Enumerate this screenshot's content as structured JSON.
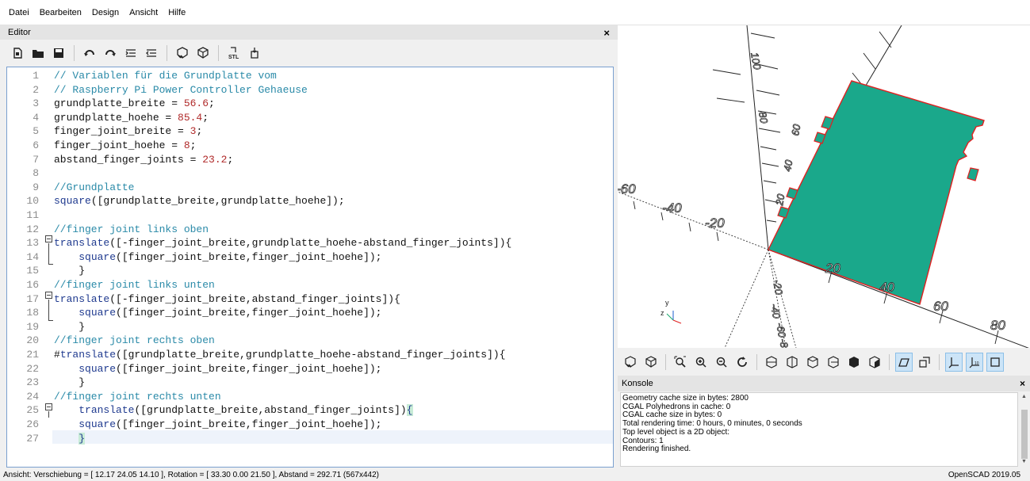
{
  "menu": [
    "Datei",
    "Bearbeiten",
    "Design",
    "Ansicht",
    "Hilfe"
  ],
  "editor": {
    "title": "Editor",
    "close": "×",
    "line_numbers": [
      "1",
      "2",
      "3",
      "4",
      "5",
      "6",
      "7",
      "8",
      "9",
      "10",
      "11",
      "12",
      "13",
      "14",
      "15",
      "16",
      "17",
      "18",
      "19",
      "20",
      "21",
      "22",
      "23",
      "24",
      "25",
      "26",
      "27"
    ],
    "lines": [
      "// Variablen für die Grundplatte vom",
      "// Raspberry Pi Power Controller Gehaeuse",
      "grundplatte_breite = 56.6;",
      "grundplatte_hoehe = 85.4;",
      "finger_joint_breite = 3;",
      "finger_joint_hoehe = 8;",
      "abstand_finger_joints = 23.2;",
      "",
      "//Grundplatte",
      "square([grundplatte_breite,grundplatte_hoehe]);",
      "",
      "//finger joint links oben",
      "translate([-finger_joint_breite,grundplatte_hoehe-abstand_finger_joints]){",
      "    square([finger_joint_breite,finger_joint_hoehe]);",
      "    }",
      "//finger joint links unten",
      "translate([-finger_joint_breite,abstand_finger_joints]){",
      "    square([finger_joint_breite,finger_joint_hoehe]);",
      "    }",
      "//finger joint rechts oben",
      "#translate([grundplatte_breite,grundplatte_hoehe-abstand_finger_joints]){",
      "    square([finger_joint_breite,finger_joint_hoehe]);",
      "    }",
      "//finger joint rechts unten",
      "    translate([grundplatte_breite,abstand_finger_joints]){",
      "    square([finger_joint_breite,finger_joint_hoehe]);",
      "    }"
    ]
  },
  "viewport": {
    "axis_labels": [
      "-60",
      "-40",
      "-20",
      "20",
      "40",
      "60",
      "80",
      "20",
      "40",
      "60",
      "80",
      "100",
      "-20",
      "-40",
      "-60",
      "-80"
    ],
    "small_axes_labels": [
      "z",
      "y"
    ],
    "colors": {
      "plate_fill": "#1aa88b",
      "plate_edge": "#e02020",
      "axis": "#222222"
    }
  },
  "console": {
    "title": "Konsole",
    "close": "×",
    "lines": [
      "Geometry cache size in bytes: 2800",
      "CGAL Polyhedrons in cache: 0",
      "CGAL cache size in bytes: 0",
      "Total rendering time: 0 hours, 0 minutes, 0 seconds",
      "Top level object is a 2D object:",
      "Contours: 1",
      "Rendering finished."
    ]
  },
  "status": {
    "left": "Ansicht: Verschiebung = [ 12.17 24.05 14.10 ], Rotation = [ 33.30 0.00 21.50 ], Abstand = 292.71 (567x442)",
    "right": "OpenSCAD 2019.05"
  },
  "icons": {
    "toolbar": [
      "new-file-icon",
      "open-file-icon",
      "save-icon",
      "undo-icon",
      "redo-icon",
      "unindent-icon",
      "indent-icon",
      "preview-icon",
      "render-icon",
      "export-stl-icon",
      "send-to-printer-icon"
    ],
    "viewbar": [
      "preview-icon",
      "render-icon",
      "zoom-all-icon",
      "zoom-in-icon",
      "zoom-out-icon",
      "reset-view-icon",
      "view-right-icon",
      "view-top-icon",
      "view-bottom-icon",
      "view-left-icon",
      "view-front-icon",
      "view-back-icon",
      "perspective-icon",
      "orthogonal-icon",
      "show-axes-icon",
      "show-scale-markers-icon",
      "show-edges-icon"
    ]
  }
}
